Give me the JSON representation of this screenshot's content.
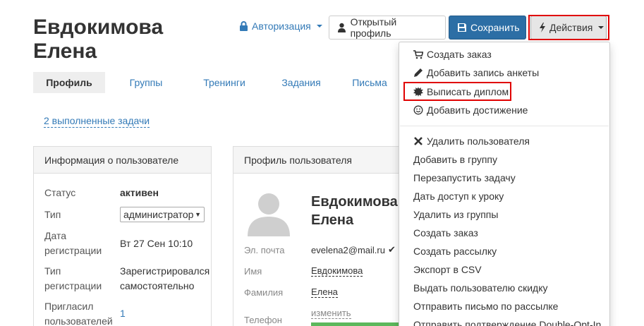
{
  "header": {
    "title": "Евдокимова Елена",
    "auth_label": "Авторизация",
    "open_profile_label": "Открытый профиль",
    "save_label": "Сохранить",
    "actions_label": "Действия"
  },
  "tabs": [
    {
      "label": "Профиль"
    },
    {
      "label": "Группы"
    },
    {
      "label": "Тренинги"
    },
    {
      "label": "Задания"
    },
    {
      "label": "Письма"
    }
  ],
  "tasks_link": "2 выполненные задачи",
  "user_info": {
    "heading": "Информация о пользователе",
    "status_label": "Статус",
    "status_value": "активен",
    "type_label": "Тип",
    "type_value": "администратор",
    "regdate_label_1": "Дата",
    "regdate_label_2": "регистрации",
    "regdate_value": "Вт 27 Сен 10:10",
    "regtype_label_1": "Тип",
    "regtype_label_2": "регистрации",
    "regtype_value_1": "Зарегистрировался",
    "regtype_value_2": "самостоятельно",
    "invited_label_1": "Пригласил",
    "invited_label_2": "пользователей",
    "invited_value": "1"
  },
  "profile": {
    "heading": "Профиль пользователя",
    "name": "Евдокимова Елена",
    "email_label": "Эл. почта",
    "email_value": "evelena2@mail.ru",
    "first_name_label": "Имя",
    "first_name_value": "Евдокимова",
    "last_name_label": "Фамилия",
    "last_name_value": "Елена",
    "phone_label": "Телефон",
    "phone_change": "изменить"
  },
  "actions_menu": {
    "group1": [
      {
        "label": "Создать заказ",
        "icon": "cart-icon"
      },
      {
        "label": "Добавить запись анкеты",
        "icon": "pencil-icon"
      },
      {
        "label": "Выписать диплом",
        "icon": "certificate-icon"
      },
      {
        "label": "Добавить достижение",
        "icon": "smile-icon"
      }
    ],
    "group2": [
      {
        "label": "Удалить пользователя",
        "icon": "times-icon"
      },
      {
        "label": "Добавить в группу"
      },
      {
        "label": "Перезапустить задачу"
      },
      {
        "label": "Дать доступ к уроку"
      },
      {
        "label": "Удалить из группы"
      },
      {
        "label": "Создать заказ"
      },
      {
        "label": "Создать рассылку"
      },
      {
        "label": "Экспорт в CSV"
      },
      {
        "label": "Выдать пользователю скидку"
      },
      {
        "label": "Отправить письмо по рассылке"
      },
      {
        "label": "Отправить подтверждение Double-Opt-In"
      }
    ]
  },
  "colors": {
    "link": "#337ab7",
    "primary": "#2c6ea5",
    "highlight": "#e00000",
    "success": "#5cb85c"
  }
}
